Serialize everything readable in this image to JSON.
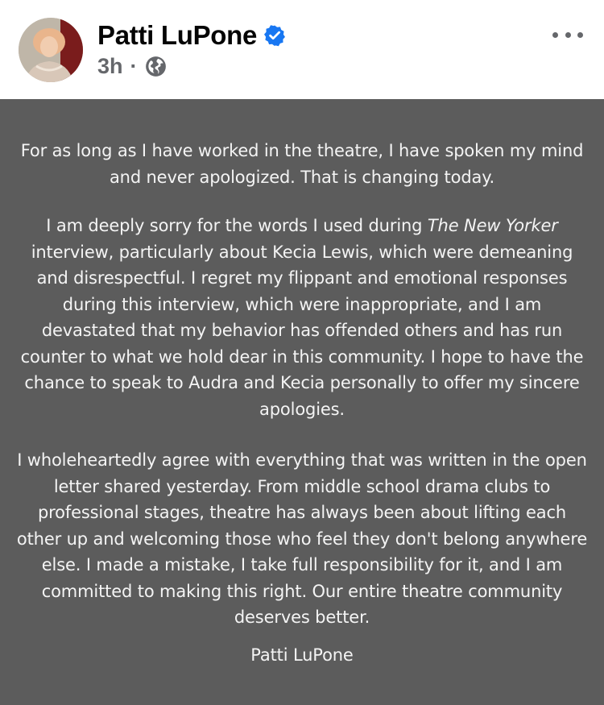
{
  "post": {
    "author": "Patti LuPone",
    "time": "3h",
    "separator": "·",
    "verified": true,
    "privacy_icon": "globe-icon",
    "more_icon": "more-horizontal-icon"
  },
  "statement": {
    "paragraph1": "For as long as I have worked in the theatre, I have spoken my mind and never apologized. That is changing today.",
    "paragraph2_before": "I am deeply sorry for the words I used during ",
    "paragraph2_italic": "The New Yorker",
    "paragraph2_after": " interview, particularly about Kecia Lewis, which were demeaning and disrespectful. I regret my flippant and emotional responses during this interview, which were inappropriate, and I am devastated that my behavior has offended others and has run counter to what we hold dear in this community. I hope to have the chance to speak to Audra and Kecia personally to offer my sincere apologies.",
    "paragraph3": "I wholeheartedly agree with everything that was written in the open letter shared yesterday. From middle school drama clubs to professional stages, theatre has always been about lifting each other up and welcoming those who feel they don't belong anywhere else. I made a mistake, I take full responsibility for it, and I am committed to making this right. Our entire theatre community deserves better.",
    "signature": "Patti LuPone"
  },
  "colors": {
    "verified_blue": "#1877f2",
    "image_background": "#5c5c5c",
    "meta_gray": "#65676b"
  }
}
